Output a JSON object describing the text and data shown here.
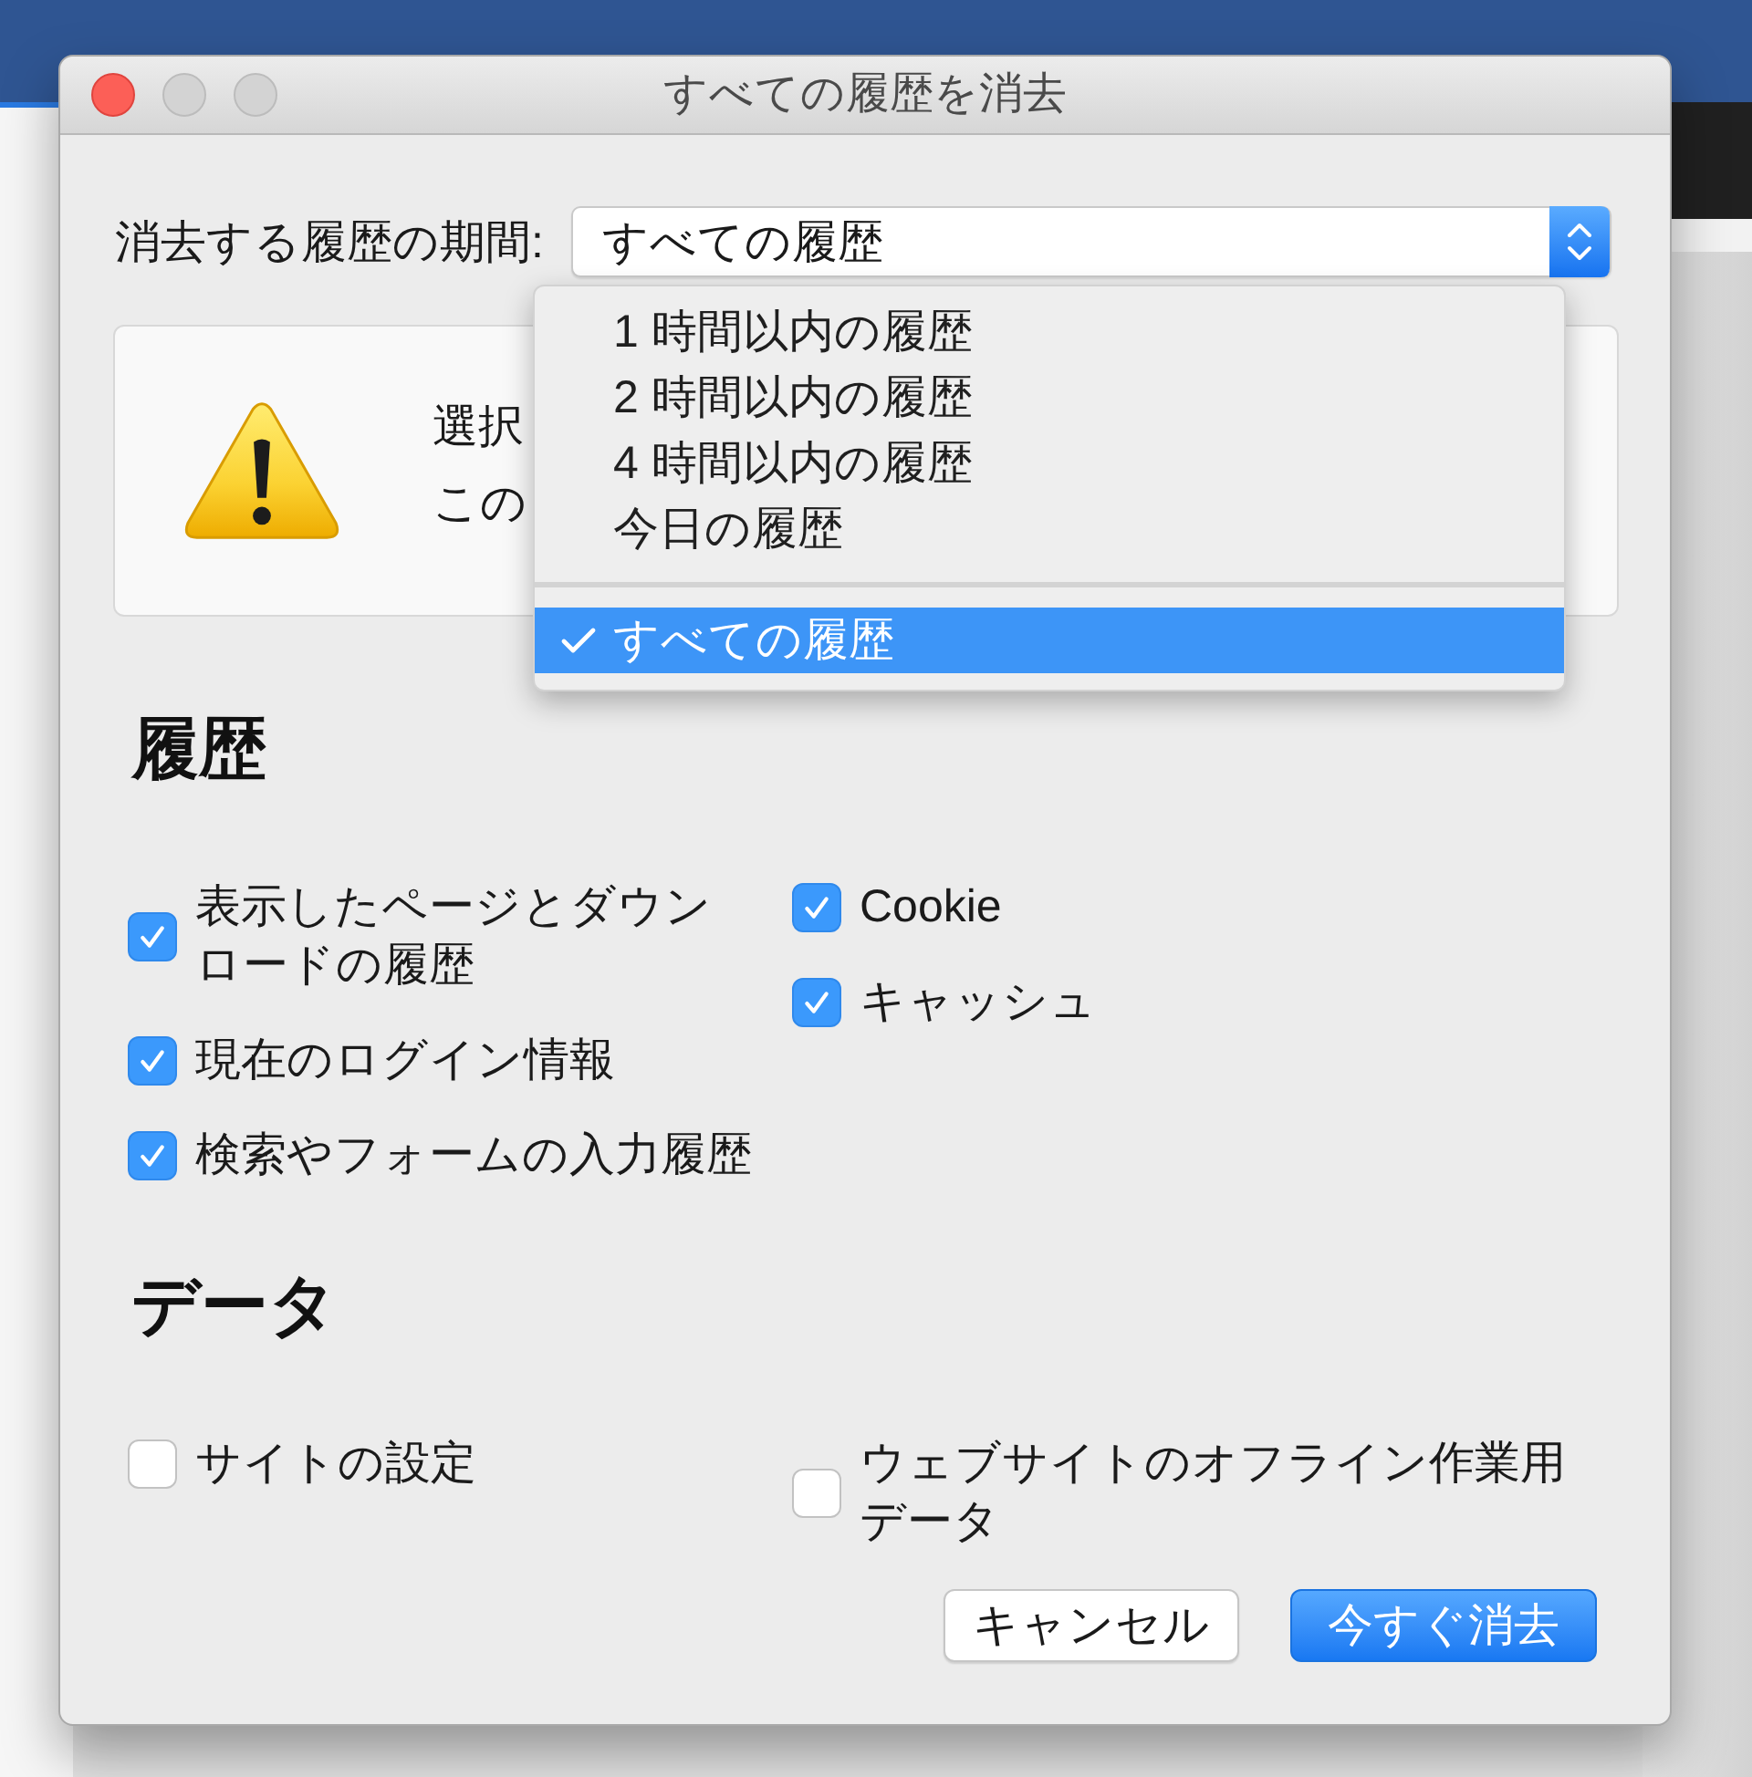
{
  "window": {
    "title": "すべての履歴を消去"
  },
  "period": {
    "label": "消去する履歴の期間:",
    "value": "すべての履歴"
  },
  "warning": {
    "lines": [
      "選択",
      "この"
    ]
  },
  "period_menu": {
    "groups": [
      [
        {
          "label": "1 時間以内の履歴",
          "selected": false
        },
        {
          "label": "2 時間以内の履歴",
          "selected": false
        },
        {
          "label": "4 時間以内の履歴",
          "selected": false
        },
        {
          "label": "今日の履歴",
          "selected": false
        }
      ],
      [
        {
          "label": "すべての履歴",
          "selected": true
        }
      ]
    ]
  },
  "sections": [
    {
      "heading": "履歴",
      "columns": [
        [
          {
            "label": "表示したページとダウンロードの履歴",
            "checked": true
          },
          {
            "label": "現在のログイン情報",
            "checked": true
          },
          {
            "label": "検索やフォームの入力履歴",
            "checked": true
          }
        ],
        [
          {
            "label": "Cookie",
            "checked": true
          },
          {
            "label": "キャッシュ",
            "checked": true
          }
        ]
      ]
    },
    {
      "heading": "データ",
      "columns": [
        [
          {
            "label": "サイトの設定",
            "checked": false
          }
        ],
        [
          {
            "label": "ウェブサイトのオフライン作業用データ",
            "checked": false
          }
        ]
      ]
    }
  ],
  "buttons": [
    {
      "label": "キャンセル",
      "kind": "secondary"
    },
    {
      "label": "今すぐ消去",
      "kind": "primary"
    }
  ]
}
